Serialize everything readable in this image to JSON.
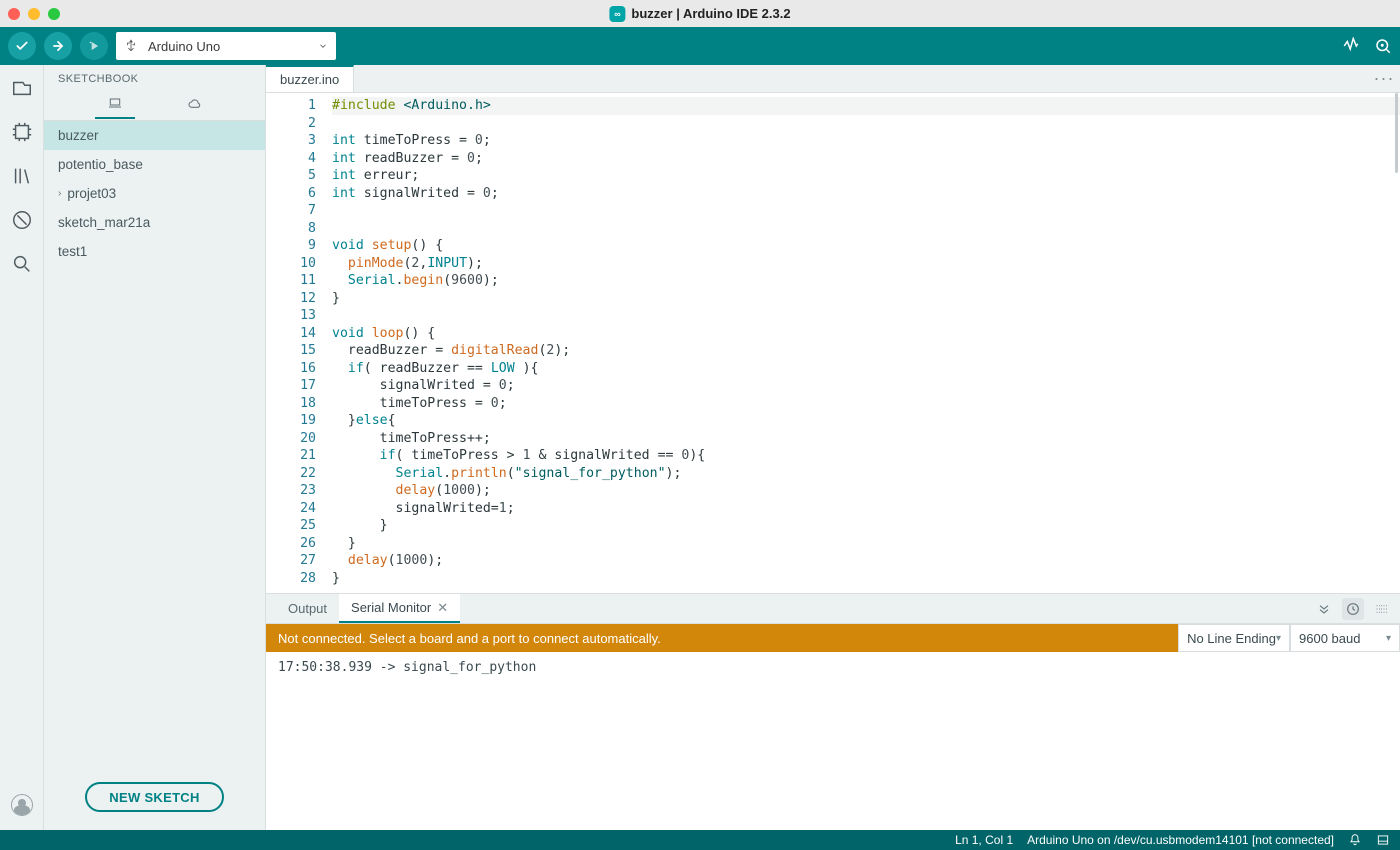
{
  "window": {
    "title": "buzzer | Arduino IDE 2.3.2",
    "app_badge": "∞"
  },
  "toolbar": {
    "verify_icon": "check",
    "upload_icon": "arrow-right",
    "debug_icon": "debug",
    "board_label": "Arduino Uno",
    "plotter_icon": "pulse",
    "monitor_icon": "magnify-o"
  },
  "sidepanel": {
    "heading": "SKETCHBOOK",
    "tabs": {
      "local": "local",
      "cloud": "cloud"
    },
    "items": [
      {
        "label": "buzzer",
        "active": true,
        "expandable": false
      },
      {
        "label": "potentio_base",
        "active": false,
        "expandable": false
      },
      {
        "label": "projet03",
        "active": false,
        "expandable": true
      },
      {
        "label": "sketch_mar21a",
        "active": false,
        "expandable": false
      },
      {
        "label": "test1",
        "active": false,
        "expandable": false
      }
    ],
    "new_sketch": "NEW SKETCH"
  },
  "editor": {
    "file_tab": "buzzer.ino",
    "more": "···"
  },
  "code_lines": [
    [
      [
        "pp",
        "#include"
      ],
      [
        "",
        " "
      ],
      [
        "st",
        "<Arduino.h>"
      ]
    ],
    [
      [
        "",
        ""
      ]
    ],
    [
      [
        "kw",
        "int"
      ],
      [
        "",
        " timeToPress = "
      ],
      [
        "nm",
        "0"
      ],
      [
        "",
        ";"
      ]
    ],
    [
      [
        "kw",
        "int"
      ],
      [
        "",
        " readBuzzer = "
      ],
      [
        "nm",
        "0"
      ],
      [
        "",
        ";"
      ]
    ],
    [
      [
        "kw",
        "int"
      ],
      [
        "",
        " erreur;"
      ]
    ],
    [
      [
        "kw",
        "int"
      ],
      [
        "",
        " signalWrited = "
      ],
      [
        "nm",
        "0"
      ],
      [
        "",
        ";"
      ]
    ],
    [
      [
        "",
        ""
      ]
    ],
    [
      [
        "",
        ""
      ]
    ],
    [
      [
        "kw",
        "void"
      ],
      [
        "",
        " "
      ],
      [
        "call",
        "setup"
      ],
      [
        "",
        "() {"
      ]
    ],
    [
      [
        "",
        "  "
      ],
      [
        "call",
        "pinMode"
      ],
      [
        "",
        "("
      ],
      [
        "nm",
        "2"
      ],
      [
        "",
        ","
      ],
      [
        "kw",
        "INPUT"
      ],
      [
        "",
        ");"
      ]
    ],
    [
      [
        "",
        "  "
      ],
      [
        "kw",
        "Serial"
      ],
      [
        "",
        "."
      ],
      [
        "call",
        "begin"
      ],
      [
        "",
        "("
      ],
      [
        "nm",
        "9600"
      ],
      [
        "",
        ");"
      ]
    ],
    [
      [
        "",
        "}"
      ]
    ],
    [
      [
        "",
        ""
      ]
    ],
    [
      [
        "kw",
        "void"
      ],
      [
        "",
        " "
      ],
      [
        "call",
        "loop"
      ],
      [
        "",
        "() {"
      ]
    ],
    [
      [
        "",
        "  readBuzzer = "
      ],
      [
        "call",
        "digitalRead"
      ],
      [
        "",
        "("
      ],
      [
        "nm",
        "2"
      ],
      [
        "",
        ");"
      ]
    ],
    [
      [
        "",
        "  "
      ],
      [
        "kw",
        "if"
      ],
      [
        "",
        "( readBuzzer == "
      ],
      [
        "kw",
        "LOW"
      ],
      [
        "",
        " ){"
      ]
    ],
    [
      [
        "",
        "      signalWrited = "
      ],
      [
        "nm",
        "0"
      ],
      [
        "",
        ";"
      ]
    ],
    [
      [
        "",
        "      timeToPress = "
      ],
      [
        "nm",
        "0"
      ],
      [
        "",
        ";"
      ]
    ],
    [
      [
        "",
        "  }"
      ],
      [
        "kw",
        "else"
      ],
      [
        "",
        "{"
      ]
    ],
    [
      [
        "",
        "      timeToPress++;"
      ]
    ],
    [
      [
        "",
        "      "
      ],
      [
        "kw",
        "if"
      ],
      [
        "",
        "( timeToPress > "
      ],
      [
        "nm",
        "1"
      ],
      [
        "",
        " & signalWrited == "
      ],
      [
        "nm",
        "0"
      ],
      [
        "",
        ")"
      ],
      [
        "",
        "{"
      ]
    ],
    [
      [
        "",
        "        "
      ],
      [
        "kw",
        "Serial"
      ],
      [
        "",
        "."
      ],
      [
        "call",
        "println"
      ],
      [
        "",
        "("
      ],
      [
        "str",
        "\"signal_for_python\""
      ],
      [
        "",
        ");"
      ]
    ],
    [
      [
        "",
        "        "
      ],
      [
        "call",
        "delay"
      ],
      [
        "",
        "("
      ],
      [
        "nm",
        "1000"
      ],
      [
        "",
        ");"
      ]
    ],
    [
      [
        "",
        "        signalWrited="
      ],
      [
        "nm",
        "1"
      ],
      [
        "",
        ";"
      ]
    ],
    [
      [
        "",
        "      }"
      ]
    ],
    [
      [
        "",
        "  }"
      ]
    ],
    [
      [
        "",
        "  "
      ],
      [
        "call",
        "delay"
      ],
      [
        "",
        "("
      ],
      [
        "nm",
        "1000"
      ],
      [
        "",
        ");"
      ]
    ],
    [
      [
        "",
        "}"
      ]
    ]
  ],
  "bottom": {
    "output_tab": "Output",
    "serial_tab": "Serial Monitor",
    "warning": "Not connected. Select a board and a port to connect automatically.",
    "line_ending": "No Line Ending",
    "baud": "9600 baud",
    "console_line": "17:50:38.939 -> signal_for_python"
  },
  "status": {
    "cursor": "Ln 1, Col 1",
    "board_info": "Arduino Uno on /dev/cu.usbmodem14101 [not connected]"
  }
}
